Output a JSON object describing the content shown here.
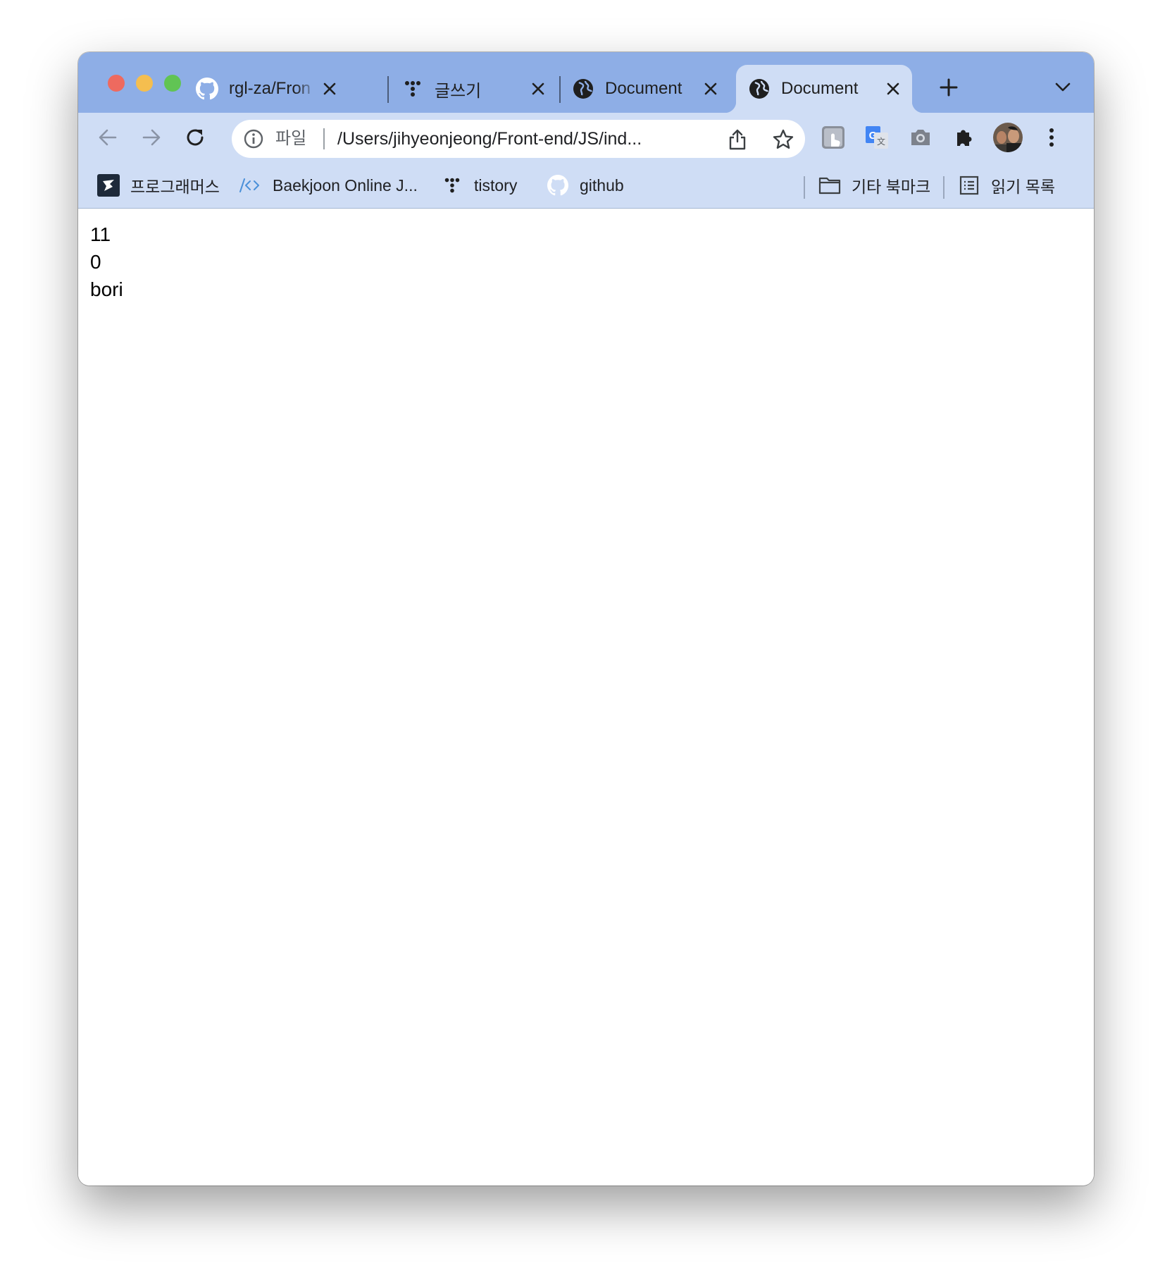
{
  "window": {
    "traffic_lights": {
      "close": "#ee6a5f",
      "minimize": "#f5be4f",
      "zoom": "#61c454"
    }
  },
  "tabs": [
    {
      "title": "rgl-za/Fron",
      "icon": "github-icon",
      "active": false
    },
    {
      "title": "글쓰기",
      "icon": "tistory-icon",
      "active": false
    },
    {
      "title": "Document",
      "icon": "globe-icon",
      "active": false
    },
    {
      "title": "Document",
      "icon": "globe-icon",
      "active": true
    }
  ],
  "toolbar": {
    "scheme_label": "파일",
    "url": "/Users/jihyeonjeong/Front-end/JS/ind...",
    "extensions": [
      "touch-extension-icon",
      "google-translate-icon",
      "camera-extension-icon",
      "puzzle-icon"
    ],
    "profile": "avatar"
  },
  "bookmarks": {
    "items": [
      {
        "label": "프로그래머스",
        "icon": "programmers-icon"
      },
      {
        "label": "Baekjoon Online J...",
        "icon": "code-icon"
      },
      {
        "label": "tistory",
        "icon": "tistory-icon"
      },
      {
        "label": "github",
        "icon": "github-icon"
      }
    ],
    "other_bookmarks": "기타 북마크",
    "reading_list": "읽기 목록"
  },
  "page": {
    "lines": [
      "11",
      "0",
      "bori"
    ]
  },
  "colors": {
    "tab_strip": "#8eaee6",
    "toolbar": "#cfddf5",
    "page_background": "#ffffff"
  }
}
